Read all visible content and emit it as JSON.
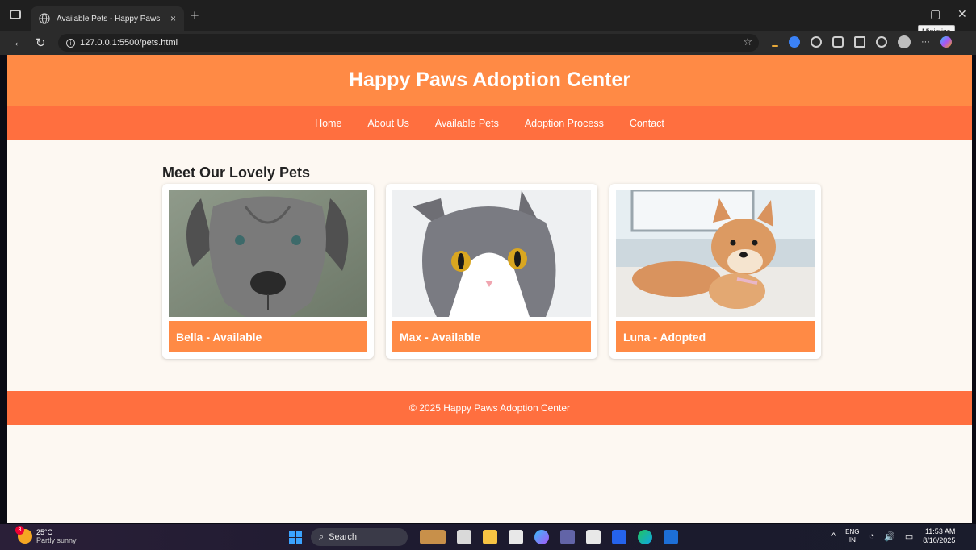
{
  "browser": {
    "tab_title": "Available Pets - Happy Paws",
    "tab_close": "×",
    "new_tab": "+",
    "url": "127.0.0.1:5500/pets.html",
    "tooltip": "Minimize",
    "win_minimize": "–",
    "win_maximize": "▢",
    "win_close": "✕",
    "back": "←",
    "reload": "↻",
    "star": "☆",
    "more": "···"
  },
  "site": {
    "title": "Happy Paws Adoption Center",
    "nav": [
      "Home",
      "About Us",
      "Available Pets",
      "Adoption Process",
      "Contact"
    ],
    "section_title": "Meet Our Lovely Pets",
    "pets": [
      {
        "caption": "Bella - Available",
        "image": "gray-dog-photo"
      },
      {
        "caption": "Max - Available",
        "image": "gray-white-cat-photo"
      },
      {
        "caption": "Luna - Adopted",
        "image": "shiba-puppy-photo"
      }
    ],
    "footer": "© 2025 Happy Paws Adoption Center",
    "colors": {
      "header": "#ff8a45",
      "nav": "#ff6f3f",
      "background": "#fdf8f2"
    }
  },
  "taskbar": {
    "weather_temp": "25°C",
    "weather_desc": "Partly sunny",
    "weather_badge": "3",
    "search_label": "Search",
    "lang_top": "ENG",
    "lang_bottom": "IN",
    "time": "11:53 AM",
    "date": "8/10/2025",
    "chevron": "^",
    "wifi": "◔",
    "volume": "🔊"
  }
}
